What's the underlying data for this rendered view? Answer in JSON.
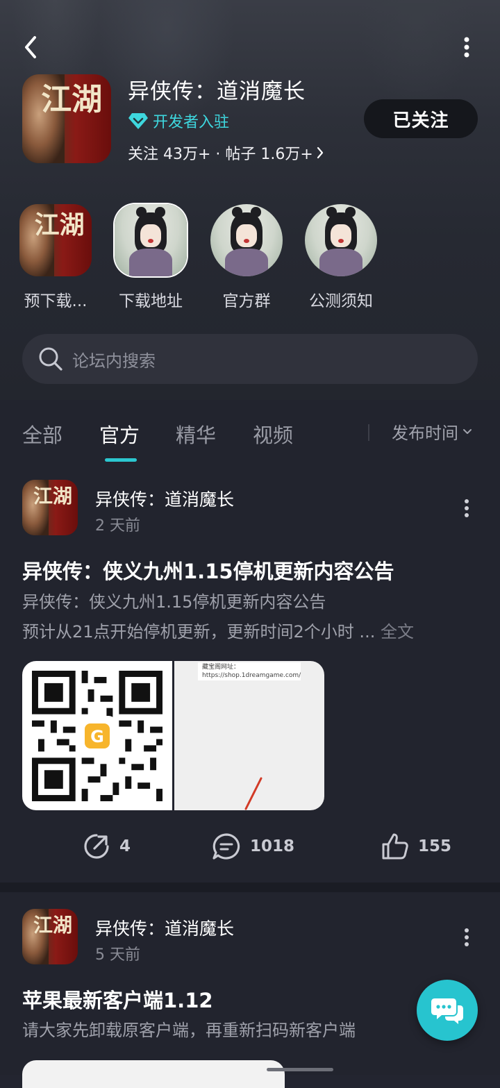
{
  "header": {
    "game_title": "异侠传：道消魔长",
    "dev_badge": "开发者入驻",
    "followers_label": "关注 43万+ · 帖子 1.6万+",
    "follow_button": "已关注",
    "icon_calligraphy": "江湖",
    "accent_color": "#3ed7de"
  },
  "shortcuts": [
    {
      "label": "预下载...",
      "icon": "jianghu-game-art"
    },
    {
      "label": "下载地址",
      "icon": "character-portrait"
    },
    {
      "label": "官方群",
      "icon": "character-portrait"
    },
    {
      "label": "公测须知",
      "icon": "character-portrait"
    }
  ],
  "search": {
    "placeholder": "论坛内搜索"
  },
  "tabs": [
    {
      "label": "全部",
      "active": false
    },
    {
      "label": "官方",
      "active": true
    },
    {
      "label": "精华",
      "active": false
    },
    {
      "label": "视频",
      "active": false
    }
  ],
  "sort": {
    "label": "发布时间"
  },
  "posts": [
    {
      "author": "异侠传：道消魔长",
      "time": "2 天前",
      "title": "异侠传：侠义九州1.15停机更新内容公告",
      "body_line1": "异侠传：侠义九州1.15停机更新内容公告",
      "body_line2": "预计从21点开始停机更新，更新时间2个小时 ...",
      "more": "全文",
      "image_caption": "藏宝阁网址：https://shop.1dreamgame.com/",
      "share_count": "4",
      "comment_count": "1018",
      "like_count": "155"
    },
    {
      "author": "异侠传：道消魔长",
      "time": "5 天前",
      "title": "苹果最新客户端1.12",
      "body_line1": "请大家先卸载原客户端，再重新扫码新客户端"
    }
  ],
  "colors": {
    "background": "#22242e",
    "tab_indicator": "#2cc7d0",
    "fab": "#27c4cf"
  }
}
